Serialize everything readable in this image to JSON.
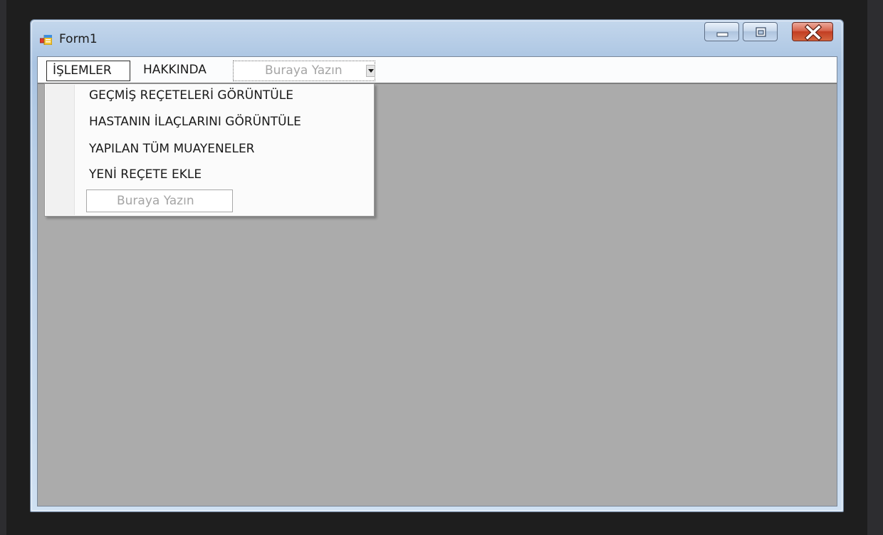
{
  "window": {
    "title": "Form1",
    "icon": "form-icon",
    "minimize_icon": "minimize-icon",
    "maximize_icon": "maximize-icon",
    "close_icon": "close-icon"
  },
  "menu": {
    "items": [
      {
        "label": "İŞLEMLER"
      },
      {
        "label": "HAKKINDA"
      }
    ],
    "type_here": "Buraya Yazın"
  },
  "dropdown": {
    "items": [
      {
        "label": "GEÇMİŞ REÇETELERİ GÖRÜNTÜLE"
      },
      {
        "label": "HASTANIN İLAÇLARINI GÖRÜNTÜLE"
      },
      {
        "label": "YAPILAN TÜM MUAYENELER"
      },
      {
        "label": "YENİ REÇETE EKLE"
      }
    ],
    "type_here": "Buraya Yazın"
  },
  "colors": {
    "client_background": "#ababab",
    "close_button": "#c94a2f",
    "designer_background": "#1e1e1e"
  }
}
